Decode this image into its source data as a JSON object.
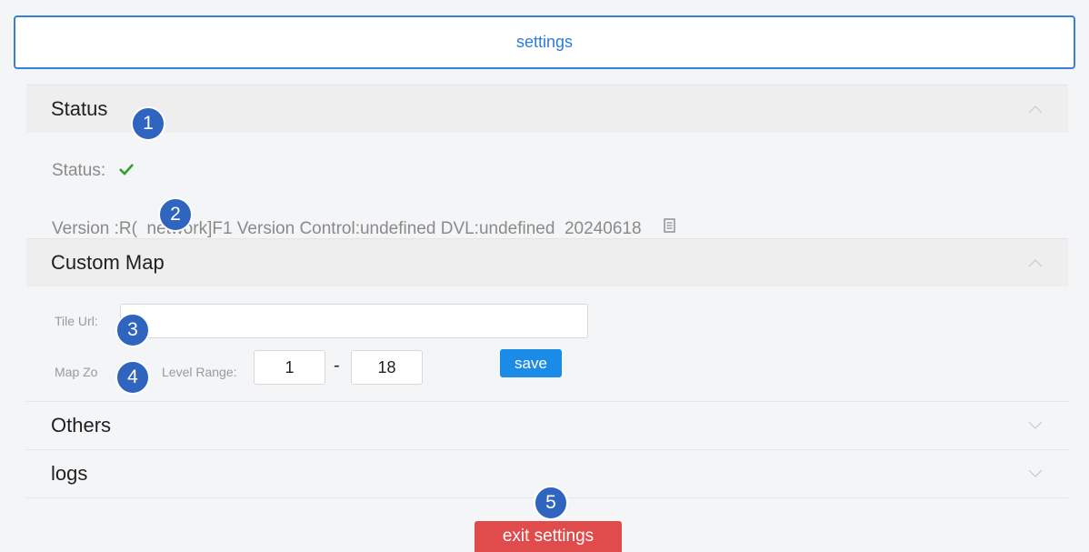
{
  "header": {
    "title": "settings"
  },
  "status_panel": {
    "title": "Status",
    "status_label": "Status:",
    "status_icon": "check-icon",
    "version_text": "Version :R(  network]F1 Version Control:undefined DVL:undefined  20240618",
    "copy_icon": "copy-icon"
  },
  "custom_map_panel": {
    "title": "Custom Map",
    "tile_url_label": "Tile Url:",
    "tile_url_value": "",
    "zoom_label_left": "Map Zo",
    "zoom_label_right": "Level Range:",
    "zoom_min": "1",
    "range_separator": "-",
    "zoom_max": "18",
    "save_label": "save"
  },
  "others_panel": {
    "title": "Others"
  },
  "logs_panel": {
    "title": "logs"
  },
  "exit_label": "exit settings",
  "badges": [
    "1",
    "2",
    "3",
    "4",
    "5"
  ],
  "colors": {
    "accent": "#2f7bd9",
    "save": "#1b8be8",
    "exit": "#e04b4b",
    "check": "#2e9e2e",
    "badge": "#2f64bf"
  }
}
